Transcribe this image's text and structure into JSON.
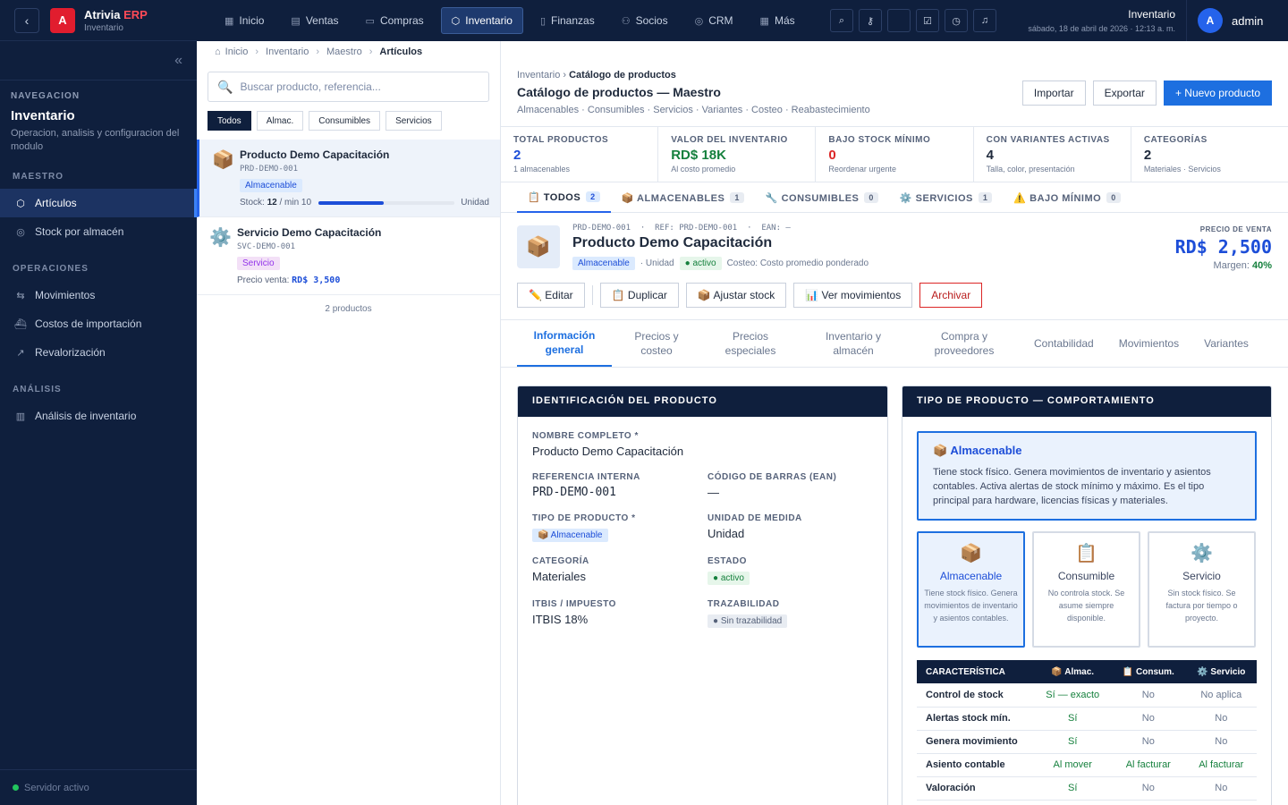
{
  "app": {
    "name": "Atrivia",
    "name_suffix": "ERP",
    "module": "Inventario",
    "logo_letter": "A"
  },
  "sidebar": {
    "nav_header": "NAVEGACION",
    "title": "Inventario",
    "description": "Operacion, analisis y configuracion del modulo",
    "sections": [
      {
        "label": "MAESTRO",
        "items": [
          {
            "label": "Artículos",
            "icon": "cube-icon",
            "active": true
          },
          {
            "label": "Stock por almacén",
            "icon": "map-pin-icon",
            "active": false
          }
        ]
      },
      {
        "label": "OPERACIONES",
        "items": [
          {
            "label": "Movimientos",
            "icon": "arrows-icon",
            "active": false
          },
          {
            "label": "Costos de importación",
            "icon": "ship-icon",
            "active": false
          },
          {
            "label": "Revalorización",
            "icon": "trend-icon",
            "active": false
          }
        ]
      },
      {
        "label": "ANÁLISIS",
        "items": [
          {
            "label": "Análisis de inventario",
            "icon": "bar-chart-icon",
            "active": false
          }
        ]
      }
    ],
    "server_status": "Servidor activo"
  },
  "topbar": {
    "tabs": [
      {
        "label": "Inicio",
        "icon": "grid-icon"
      },
      {
        "label": "Ventas",
        "icon": "receipt-icon"
      },
      {
        "label": "Compras",
        "icon": "cart-icon"
      },
      {
        "label": "Inventario",
        "icon": "cube-icon",
        "active": true
      },
      {
        "label": "Finanzas",
        "icon": "book-icon"
      },
      {
        "label": "Socios",
        "icon": "people-icon"
      },
      {
        "label": "CRM",
        "icon": "target-icon"
      },
      {
        "label": "Más",
        "icon": "grid-icon"
      }
    ],
    "module": "Inventario",
    "datetime": "sábado, 18 de abril de 2026 · 12:13 a. m.",
    "user": {
      "initial": "A",
      "name": "admin"
    }
  },
  "list": {
    "breadcrumb": [
      "Inicio",
      "Inventario",
      "Maestro",
      "Artículos"
    ],
    "search_placeholder": "Buscar producto, referencia...",
    "filters": [
      "Todos",
      "Almac.",
      "Consumibles",
      "Servicios"
    ],
    "items": [
      {
        "name": "Producto Demo Capacitación",
        "code": "PRD-DEMO-001",
        "type": "Almacenable",
        "stock_label": "Stock:",
        "stock": "12",
        "min_label": "/ min 10",
        "stock_fill": 0.48,
        "unit": "Unidad",
        "icon": "box-icon"
      },
      {
        "name": "Servicio Demo Capacitación",
        "code": "SVC-DEMO-001",
        "type": "Servicio",
        "price_label": "Precio venta:",
        "price": "RD$ 3,500",
        "icon": "gear-icon"
      }
    ],
    "count": "2 productos"
  },
  "main": {
    "breadcrumb": {
      "parent": "Inventario",
      "current": "Catálogo de productos"
    },
    "title": "Catálogo de productos — Maestro",
    "subtitle": "Almacenables · Consumibles · Servicios · Variantes · Costeo · Reabastecimiento",
    "actions": {
      "import": "Importar",
      "export": "Exportar",
      "new": "+ Nuevo producto"
    },
    "kpis": [
      {
        "label": "TOTAL PRODUCTOS",
        "value": "2",
        "sub": "1 almacenables",
        "color": "blue"
      },
      {
        "label": "VALOR DEL INVENTARIO",
        "value": "RD$ 18K",
        "sub": "Al costo promedio",
        "color": "green"
      },
      {
        "label": "BAJO STOCK MÍNIMO",
        "value": "0",
        "sub": "Reordenar urgente",
        "color": "red"
      },
      {
        "label": "CON VARIANTES ACTIVAS",
        "value": "4",
        "sub": "Talla, color, presentación",
        "color": ""
      },
      {
        "label": "CATEGORÍAS",
        "value": "2",
        "sub": "Materiales · Servicios",
        "color": ""
      }
    ],
    "filter_tabs": [
      {
        "label": "📋 TODOS",
        "count": "2",
        "on": true
      },
      {
        "label": "📦 ALMACENABLES",
        "count": "1"
      },
      {
        "label": "🔧 CONSUMIBLES",
        "count": "0"
      },
      {
        "label": "⚙️ SERVICIOS",
        "count": "1"
      },
      {
        "label": "⚠️ BAJO MÍNIMO",
        "count": "0"
      }
    ],
    "product": {
      "codes": "PRD-DEMO-001  ·  REF: PRD-DEMO-001  ·  EAN: —",
      "name": "Producto Demo Capacitación",
      "type": "Almacenable",
      "unit": "· Unidad",
      "status": "● activo",
      "costing": "Costeo: Costo promedio ponderado",
      "price_label": "PRECIO DE VENTA",
      "price": "RD$ 2,500",
      "margin_label": "Margen:",
      "margin": "40%",
      "buttons": {
        "edit": "✏️ Editar",
        "duplicate": "📋 Duplicar",
        "adjust": "📦 Ajustar stock",
        "movements": "📊 Ver movimientos",
        "archive": "Archivar"
      }
    },
    "detail_tabs": [
      "Información general",
      "Precios y costeo",
      "Precios especiales",
      "Inventario y almacén",
      "Compra y proveedores",
      "Contabilidad",
      "Movimientos",
      "Variantes"
    ],
    "identification": {
      "header": "IDENTIFICACIÓN DEL PRODUCTO",
      "full_name_label": "NOMBRE COMPLETO *",
      "full_name": "Producto Demo Capacitación",
      "ref_label": "REFERENCIA INTERNA",
      "ref": "PRD-DEMO-001",
      "ean_label": "CÓDIGO DE BARRAS (EAN)",
      "ean": "—",
      "type_label": "TIPO DE PRODUCTO *",
      "type": "📦 Almacenable",
      "unit_label": "UNIDAD DE MEDIDA",
      "unit": "Unidad",
      "category_label": "CATEGORÍA",
      "category": "Materiales",
      "status_label": "ESTADO",
      "status": "● activo",
      "tax_label": "ITBIS / IMPUESTO",
      "tax": "ITBIS 18%",
      "trace_label": "TRAZABILIDAD",
      "trace": "● Sin trazabilidad"
    },
    "behaviour": {
      "header": "TIPO DE PRODUCTO — COMPORTAMIENTO",
      "info_title": "📦 Almacenable",
      "info_desc": "Tiene stock físico. Genera movimientos de inventario y asientos contables. Activa alertas de stock mínimo y máximo. Es el tipo principal para hardware, licencias físicas y materiales.",
      "options": [
        {
          "icon": "📦",
          "name": "Almacenable",
          "desc": "Tiene stock físico. Genera movimientos de inventario y asientos contables.",
          "on": true
        },
        {
          "icon": "📋",
          "name": "Consumible",
          "desc": "No controla stock. Se asume siempre disponible."
        },
        {
          "icon": "⚙️",
          "name": "Servicio",
          "desc": "Sin stock físico. Se factura por tiempo o proyecto."
        }
      ],
      "table": {
        "headers": [
          "CARACTERÍSTICA",
          "📦 Almac.",
          "📋 Consum.",
          "⚙️ Servicio"
        ],
        "rows": [
          [
            "Control de stock",
            "Sí — exacto",
            "No",
            "No aplica"
          ],
          [
            "Alertas stock mín.",
            "Sí",
            "No",
            "No"
          ],
          [
            "Genera movimiento",
            "Sí",
            "No",
            "No"
          ],
          [
            "Asiento contable",
            "Al mover",
            "Al facturar",
            "Al facturar"
          ],
          [
            "Valoración",
            "Sí",
            "No",
            "No"
          ]
        ]
      }
    }
  }
}
